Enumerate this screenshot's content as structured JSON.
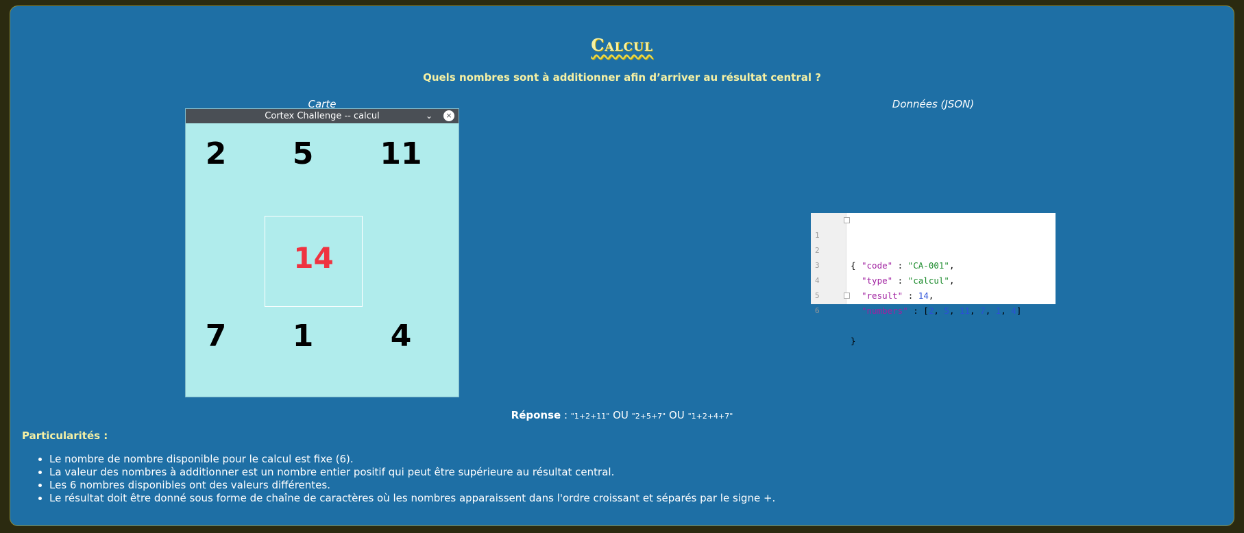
{
  "page": {
    "title": "Calcul",
    "question": "Quels nombres sont à additionner afin d’arriver au résultat central ?"
  },
  "labels": {
    "card": "Carte",
    "data": "Données (JSON)"
  },
  "window": {
    "title": "Cortex Challenge -- calcul",
    "chevron": "⌄",
    "close": "×"
  },
  "card": {
    "top": [
      "2",
      "5",
      "11"
    ],
    "bottom": [
      "7",
      "1",
      "4"
    ],
    "center": "14"
  },
  "json_panel": {
    "line_numbers": [
      "1",
      "2",
      "3",
      "4",
      "5",
      "6"
    ],
    "open_brace": "{",
    "close_brace": "}",
    "code_key": "\"code\"",
    "code_value": "\"CA-001\"",
    "type_key": "\"type\"",
    "type_value": "\"calcul\"",
    "result_key": "\"result\"",
    "result_value": "14",
    "numbers_key": "\"numbers\"",
    "numbers_values": [
      "2",
      "5",
      "11",
      "7",
      "1",
      "4"
    ]
  },
  "answer": {
    "label": "Réponse",
    "separator": " : ",
    "options": [
      "\"1+2+11\"",
      "\"2+5+7\"",
      "\"1+2+4+7\""
    ],
    "or": " OU "
  },
  "particularites": {
    "heading": "Particularités :",
    "items": [
      "Le nombre de nombre disponible pour le calcul est fixe (6).",
      "La valeur des nombres à additionner est un nombre entier positif qui peut être supérieure au résultat central.",
      "Les 6 nombres disponibles ont des valeurs différentes.",
      "Le résultat doit être donné sous forme de chaîne de caractères où les nombres apparaissent dans l'ordre croissant et séparés par le signe +."
    ]
  },
  "colors": {
    "background": "#1e6fa5",
    "card": "#b0ecec",
    "center_number": "#ef3340",
    "heading": "#f6f1a4"
  }
}
